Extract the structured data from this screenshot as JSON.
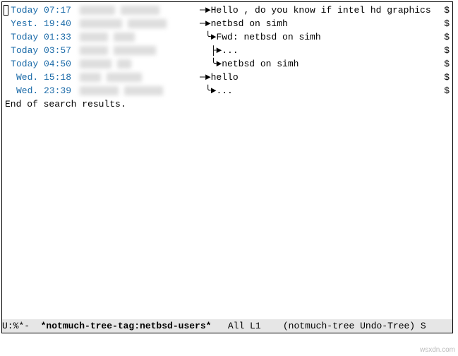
{
  "messages": [
    {
      "datetime": "Today 07:17",
      "tree": "─►",
      "subject": "Hello , do you know if intel hd graphics",
      "overflow": true
    },
    {
      "datetime": "Yest. 19:40",
      "tree": "─►",
      "subject": "netbsd on simh",
      "overflow": true
    },
    {
      "datetime": "Today 01:33",
      "tree": " ╰►",
      "subject": "Fwd: netbsd on simh",
      "overflow": true
    },
    {
      "datetime": "Today 03:57",
      "tree": "  ├►",
      "subject": " ...",
      "overflow": true
    },
    {
      "datetime": "Today 04:50",
      "tree": "  ╰►",
      "subject": " netbsd on simh",
      "overflow": true
    },
    {
      "datetime": "Wed. 15:18",
      "tree": "─►",
      "subject": "hello",
      "overflow": true
    },
    {
      "datetime": "Wed. 23:39",
      "tree": " ╰►",
      "subject": " ...",
      "overflow": true
    }
  ],
  "end_of_results": "End of search results.",
  "modeline": {
    "left": "U:%*-  ",
    "buffer": "*notmuch-tree-tag:netbsd-users*",
    "mid": "   All L1    ",
    "modes": "(notmuch-tree Undo-Tree) S"
  },
  "overflow_char": "$",
  "watermark": "wsxdn.com"
}
